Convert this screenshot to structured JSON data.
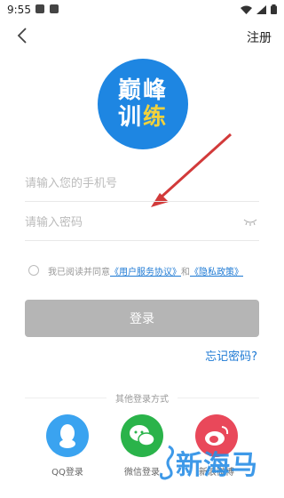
{
  "status_bar": {
    "time": "9:55"
  },
  "header": {
    "register_label": "注册"
  },
  "logo": {
    "line1": "巅峰",
    "line2a": "训",
    "line2b": "练"
  },
  "form": {
    "phone_placeholder": "请输入您的手机号",
    "password_placeholder": "请输入密码",
    "agreement_prefix": "我已阅读并同意",
    "agreement_terms": "《用户服务协议》",
    "agreement_and": "和",
    "agreement_privacy": "《隐私政策》",
    "login_label": "登录",
    "forgot_label": "忘记密码?"
  },
  "other_login": {
    "title": "其他登录方式",
    "items": [
      {
        "label": "QQ登录",
        "icon": "qq-icon"
      },
      {
        "label": "微信登录",
        "icon": "wechat-icon"
      },
      {
        "label": "新浪微博",
        "icon": "weibo-icon"
      }
    ]
  },
  "watermark": {
    "text": "新海马"
  },
  "colors": {
    "accent": "#1e7ad4",
    "logo_bg": "#1e86e2",
    "button_disabled": "#b5b5b5"
  }
}
